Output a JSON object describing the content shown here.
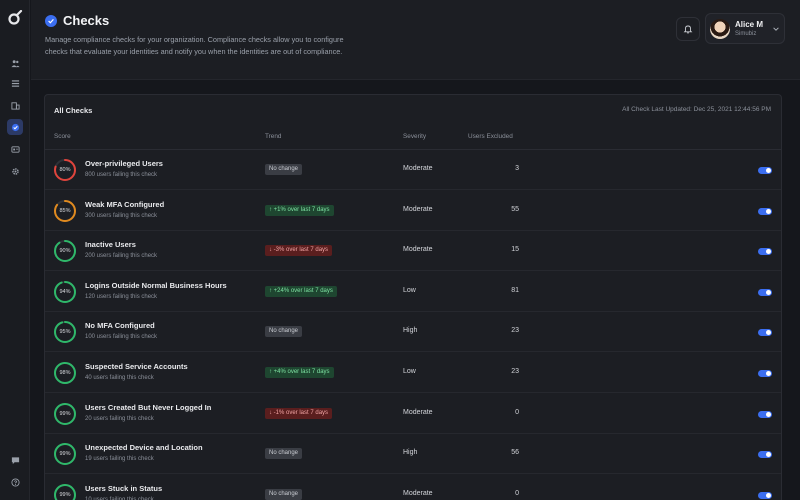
{
  "sidebar": {
    "logo_icon": "app-logo",
    "items": [
      {
        "icon": "users-icon"
      },
      {
        "icon": "list-icon"
      },
      {
        "icon": "building-icon"
      },
      {
        "icon": "check-badge-icon",
        "active": true
      },
      {
        "icon": "id-card-icon"
      },
      {
        "icon": "gear-icon"
      }
    ],
    "bottom_items": [
      {
        "icon": "chat-icon"
      },
      {
        "icon": "help-icon"
      }
    ]
  },
  "header": {
    "title": "Checks",
    "description": "Manage compliance checks for your organization. Compliance checks allow you to configure checks that evaluate your identities and notify you when the identities are out of compliance."
  },
  "user": {
    "name": "Alice M",
    "org": "Simubiz"
  },
  "table": {
    "title": "All Checks",
    "last_updated": "All Check Last Updated: Dec 25, 2021 12:44:56 PM",
    "columns": {
      "score": "Score",
      "trend": "Trend",
      "severity": "Severity",
      "excluded": "Users Excluded"
    },
    "rows": [
      {
        "score": 80,
        "score_label": "80%",
        "ring_color": "#e0443c",
        "name": "Over-privileged Users",
        "sub": "800 users failing this check",
        "trend": "No change",
        "trend_type": "neutral",
        "severity": "Moderate",
        "excluded": "3",
        "enabled": true
      },
      {
        "score": 85,
        "score_label": "85%",
        "ring_color": "#e08a1f",
        "name": "Weak MFA Configured",
        "sub": "300 users failing this check",
        "trend": "↑ +1% over last 7 days",
        "trend_type": "up",
        "severity": "Moderate",
        "excluded": "55",
        "enabled": true
      },
      {
        "score": 90,
        "score_label": "90%",
        "ring_color": "#2fb86a",
        "name": "Inactive Users",
        "sub": "200 users failing this check",
        "trend": "↓ -3% over last 7 days",
        "trend_type": "down",
        "severity": "Moderate",
        "excluded": "15",
        "enabled": true
      },
      {
        "score": 94,
        "score_label": "94%",
        "ring_color": "#2fb86a",
        "name": "Logins Outside Normal Business Hours",
        "sub": "120 users failing this check",
        "trend": "↑ +24% over last 7 days",
        "trend_type": "up",
        "severity": "Low",
        "excluded": "81",
        "enabled": true
      },
      {
        "score": 95,
        "score_label": "95%",
        "ring_color": "#2fb86a",
        "name": "No MFA Configured",
        "sub": "100 users failing this check",
        "trend": "No change",
        "trend_type": "neutral",
        "severity": "High",
        "excluded": "23",
        "enabled": true
      },
      {
        "score": 98,
        "score_label": "98%",
        "ring_color": "#2fb86a",
        "name": "Suspected Service Accounts",
        "sub": "40 users failing this check",
        "trend": "↑ +4% over last 7 days",
        "trend_type": "up",
        "severity": "Low",
        "excluded": "23",
        "enabled": true
      },
      {
        "score": 99,
        "score_label": "99%",
        "ring_color": "#2fb86a",
        "name": "Users Created But Never Logged In",
        "sub": "20 users failing this check",
        "trend": "↓ -1% over last 7 days",
        "trend_type": "down",
        "severity": "Moderate",
        "excluded": "0",
        "enabled": true
      },
      {
        "score": 99,
        "score_label": "99%",
        "ring_color": "#2fb86a",
        "name": "Unexpected Device and Location",
        "sub": "19 users failing this check",
        "trend": "No change",
        "trend_type": "neutral",
        "severity": "High",
        "excluded": "56",
        "enabled": true
      },
      {
        "score": 99,
        "score_label": "99%",
        "ring_color": "#2fb86a",
        "name": "Users Stuck in Status",
        "sub": "10 users failing this check",
        "trend": "No change",
        "trend_type": "neutral",
        "severity": "Moderate",
        "excluded": "0",
        "enabled": true
      }
    ]
  }
}
